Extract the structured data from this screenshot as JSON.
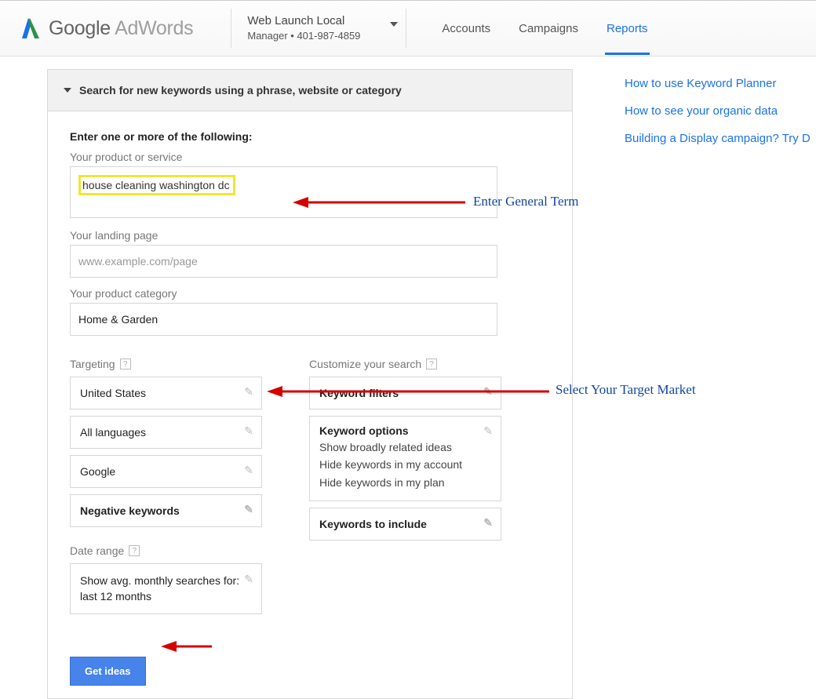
{
  "header": {
    "brand_main": "Google",
    "brand_sub": " AdWords",
    "account_name": "Web Launch Local",
    "account_sub": "Manager  •  401-987-4859",
    "nav": {
      "accounts": "Accounts",
      "campaigns": "Campaigns",
      "reports": "Reports"
    }
  },
  "panel": {
    "title": "Search for new keywords using a phrase, website or category",
    "lead": "Enter one or more of the following:",
    "product_label": "Your product or service",
    "product_value": "house cleaning washington dc",
    "landing_label": "Your landing page",
    "landing_placeholder": "www.example.com/page",
    "category_label": "Your product category",
    "category_value": "Home & Garden",
    "targeting_head": "Targeting",
    "targeting": {
      "location": "United States",
      "languages": "All languages",
      "network": "Google",
      "negative": "Negative keywords"
    },
    "daterange_head": "Date range",
    "daterange_value": "Show avg. monthly searches for: last 12 months",
    "customize_head": "Customize your search",
    "kw_filters": "Keyword filters",
    "kw_options_head": "Keyword options",
    "kw_options_lines": {
      "a": "Show broadly related ideas",
      "b": "Hide keywords in my account",
      "c": "Hide keywords in my plan"
    },
    "kw_include": "Keywords to include",
    "submit": "Get ideas"
  },
  "sidebar": {
    "link1": "How to use Keyword Planner",
    "link2": "How to see your organic data",
    "link3": "Building a Display campaign? Try D"
  },
  "annotations": {
    "enter_term": "Enter General Term",
    "select_market": "Select Your Target Market"
  }
}
